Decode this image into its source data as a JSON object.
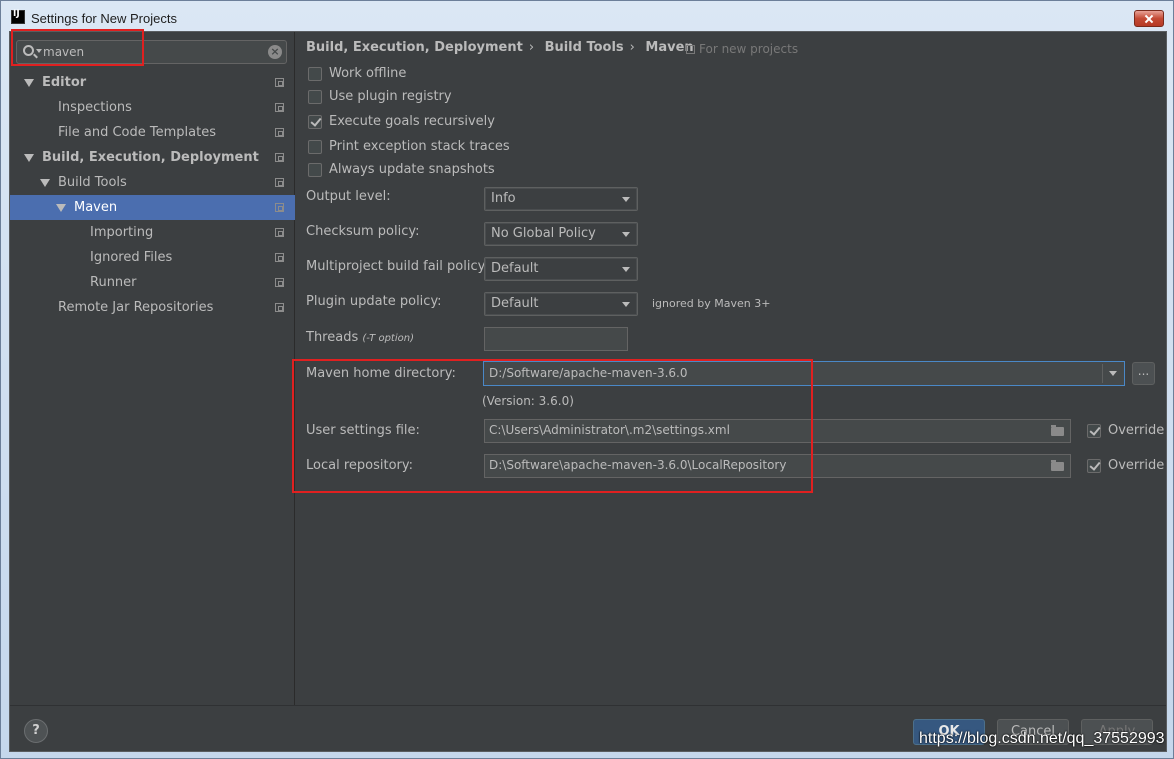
{
  "window": {
    "title": "Settings for New Projects"
  },
  "search": {
    "value": "maven"
  },
  "tree": [
    {
      "label": "Editor",
      "bold": true,
      "expanded": true,
      "level": 0,
      "selected": false
    },
    {
      "label": "Inspections",
      "bold": false,
      "level": 1,
      "selected": false
    },
    {
      "label": "File and Code Templates",
      "bold": false,
      "level": 1,
      "selected": false
    },
    {
      "label": "Build, Execution, Deployment",
      "bold": true,
      "expanded": true,
      "level": 0,
      "selected": false
    },
    {
      "label": "Build Tools",
      "bold": false,
      "expanded": true,
      "level": 1,
      "selected": false
    },
    {
      "label": "Maven",
      "bold": false,
      "expanded": true,
      "level": 2,
      "selected": true
    },
    {
      "label": "Importing",
      "bold": false,
      "level": 3,
      "selected": false
    },
    {
      "label": "Ignored Files",
      "bold": false,
      "level": 3,
      "selected": false
    },
    {
      "label": "Runner",
      "bold": false,
      "level": 3,
      "selected": false
    },
    {
      "label": "Remote Jar Repositories",
      "bold": false,
      "level": 1,
      "selected": false
    }
  ],
  "breadcrumb": {
    "part1": "Build, Execution, Deployment",
    "part2": "Build Tools",
    "part3": "Maven",
    "separator": "›",
    "scope": "For new projects"
  },
  "checkboxes": [
    {
      "label": "Work offline",
      "checked": false
    },
    {
      "label": "Use plugin registry",
      "checked": false
    },
    {
      "label": "Execute goals recursively",
      "checked": true
    },
    {
      "label": "Print exception stack traces",
      "checked": false
    },
    {
      "label": "Always update snapshots",
      "checked": false
    }
  ],
  "fields": {
    "output_level_label": "Output level:",
    "output_level_value": "Info",
    "checksum_label": "Checksum policy:",
    "checksum_value": "No Global Policy",
    "multiproject_label": "Multiproject build fail policy:",
    "multiproject_value": "Default",
    "plugin_update_label": "Plugin update policy:",
    "plugin_update_value": "Default",
    "plugin_update_note": "ignored by Maven 3+",
    "threads_label": "Threads",
    "threads_hint": "(-T option)",
    "threads_value": "",
    "maven_home_label": "Maven home directory:",
    "maven_home_value": "D:/Software/apache-maven-3.6.0",
    "maven_home_browse": "...",
    "version_text": "(Version: 3.6.0)",
    "user_settings_label": "User settings file:",
    "user_settings_value": "C:\\Users\\Administrator\\.m2\\settings.xml",
    "user_settings_override": "Override",
    "local_repo_label": "Local repository:",
    "local_repo_value": "D:\\Software\\apache-maven-3.6.0\\LocalRepository",
    "local_repo_override": "Override"
  },
  "buttons": {
    "help": "?",
    "ok": "OK",
    "cancel": "Cancel",
    "apply": "Apply"
  },
  "watermark": "https://blog.csdn.net/qq_37552993",
  "colors": {
    "background": "#3c3f41",
    "selection": "#4b6eaf",
    "highlight_box": "#e02020",
    "ok_button": "#365880"
  }
}
